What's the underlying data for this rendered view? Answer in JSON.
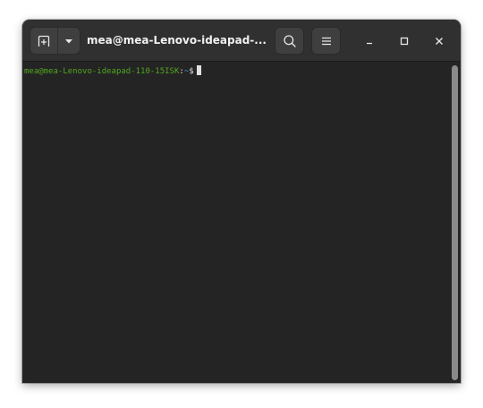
{
  "window": {
    "title": "mea@mea-Lenovo-ideapad-..."
  },
  "headerbar": {
    "new_tab_icon": "new-tab-icon",
    "dropdown_icon": "chevron-down-icon",
    "search_icon": "search-icon",
    "menu_icon": "hamburger-menu-icon",
    "minimize_icon": "minimize-icon",
    "maximize_icon": "maximize-icon",
    "close_icon": "close-icon"
  },
  "terminal": {
    "user_host": "mea@mea-Lenovo-ideapad-110-15ISK",
    "colon": ":",
    "path": "~",
    "dollar": "$"
  },
  "colors": {
    "background": "#242424",
    "headerbar": "#303030",
    "prompt_user": "#52a71e",
    "prompt_path": "#4f8fd8"
  }
}
